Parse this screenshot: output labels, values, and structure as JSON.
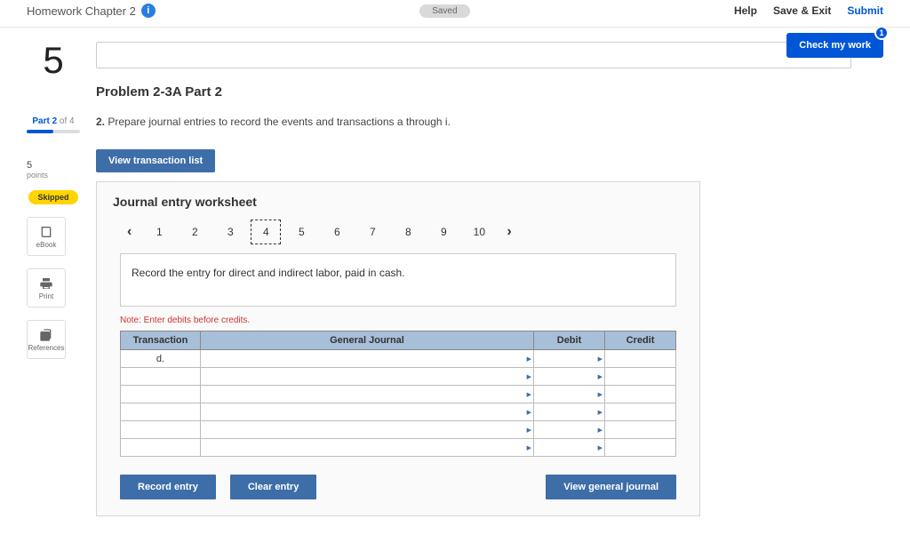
{
  "header": {
    "title": "Homework Chapter 2",
    "status_pill": "Saved",
    "help": "Help",
    "save_exit": "Save & Exit",
    "submit": "Submit"
  },
  "check_work": {
    "label": "Check my work",
    "count": "1"
  },
  "left": {
    "question_number": "5",
    "part_label": "Part 2",
    "part_of": " of 4",
    "points_value": "5",
    "points_label": "points",
    "skipped": "Skipped",
    "tools": {
      "ebook": "eBook",
      "print": "Print",
      "references": "References"
    }
  },
  "problem": {
    "title": "Problem 2-3A Part 2",
    "number": "2.",
    "text": " Prepare journal entries to record the events and transactions a through i.",
    "view_list_btn": "View transaction list"
  },
  "worksheet": {
    "title": "Journal entry worksheet",
    "steps": [
      "1",
      "2",
      "3",
      "4",
      "5",
      "6",
      "7",
      "8",
      "9",
      "10"
    ],
    "active_step_index": 3,
    "entry_description": "Record the entry for direct and indirect labor, paid in cash.",
    "note": "Note: Enter debits before credits.",
    "columns": {
      "transaction": "Transaction",
      "general_journal": "General Journal",
      "debit": "Debit",
      "credit": "Credit"
    },
    "rows": [
      {
        "transaction": "d.",
        "gj": "",
        "debit": "",
        "credit": ""
      },
      {
        "transaction": "",
        "gj": "",
        "debit": "",
        "credit": ""
      },
      {
        "transaction": "",
        "gj": "",
        "debit": "",
        "credit": ""
      },
      {
        "transaction": "",
        "gj": "",
        "debit": "",
        "credit": ""
      },
      {
        "transaction": "",
        "gj": "",
        "debit": "",
        "credit": ""
      },
      {
        "transaction": "",
        "gj": "",
        "debit": "",
        "credit": ""
      }
    ],
    "buttons": {
      "record": "Record entry",
      "clear": "Clear entry",
      "view_journal": "View general journal"
    }
  }
}
